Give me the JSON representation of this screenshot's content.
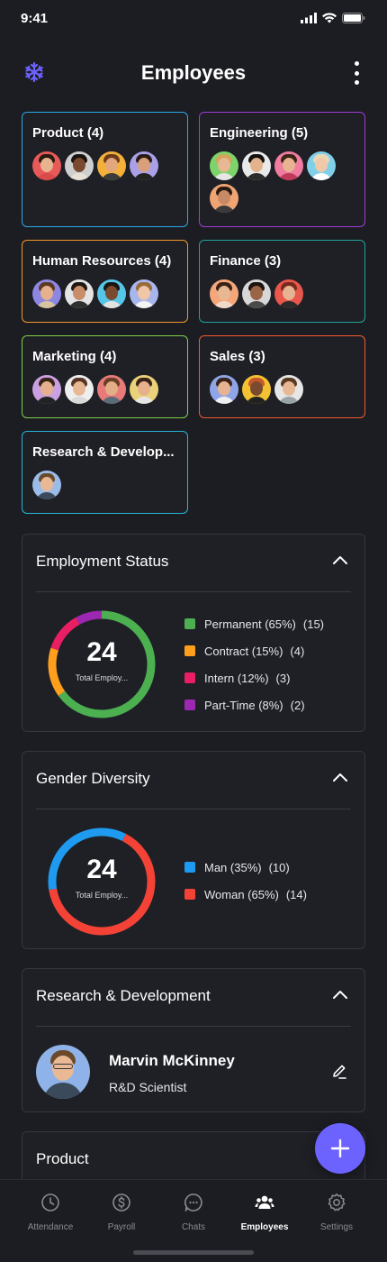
{
  "status_bar": {
    "time": "9:41"
  },
  "header": {
    "title": "Employees",
    "logo_icon": "snowflake-logo-icon",
    "menu_icon": "more-vertical-icon"
  },
  "departments": [
    {
      "name": "Product (4)",
      "border": "#2aa8e8",
      "avatars": [
        {
          "bg": "#e85a5a",
          "skin": "#e8b48f",
          "hair": "#2b1a12",
          "shirt": "#d94b4b"
        },
        {
          "bg": "#cfcfcf",
          "skin": "#7a4a2e",
          "hair": "#1b1410",
          "shirt": "#e8e2d6"
        },
        {
          "bg": "#f3b13a",
          "skin": "#e3a77d",
          "hair": "#6b3b1c",
          "shirt": "#3b3b3b"
        },
        {
          "bg": "#a9a0e8",
          "skin": "#d9a07b",
          "hair": "#2a1c15",
          "shirt": "#222"
        }
      ]
    },
    {
      "name": "Engineering (5)",
      "border": "#a33ad6",
      "avatars": [
        {
          "bg": "#7ed36a",
          "skin": "#e8b892",
          "hair": "#d3a45c",
          "shirt": "#e5e5e5"
        },
        {
          "bg": "#e9e9e9",
          "skin": "#e2b38c",
          "hair": "#111",
          "shirt": "#2b2b2b"
        },
        {
          "bg": "#f07ca0",
          "skin": "#e7b391",
          "hair": "#3a2418",
          "shirt": "#c23a5a"
        },
        {
          "bg": "#7fd0e8",
          "skin": "#efc9a9",
          "hair": "#e9d8b8",
          "shirt": "#fff"
        },
        {
          "bg": "#f0a474",
          "skin": "#c88a64",
          "hair": "#2b1a12",
          "shirt": "#3a3a3a"
        }
      ]
    },
    {
      "name": "Human Resources (4)",
      "border": "#f0982a",
      "avatars": [
        {
          "bg": "#8e86e3",
          "skin": "#e6b18c",
          "hair": "#5a3a22",
          "shirt": "#d8c3a0"
        },
        {
          "bg": "#e4e4e4",
          "skin": "#c98d6a",
          "hair": "#1f1712",
          "shirt": "#2f2f2f"
        },
        {
          "bg": "#55c6e8",
          "skin": "#7a4a2e",
          "hair": "#1b1410",
          "shirt": "#e2e2e2"
        },
        {
          "bg": "#a7b6ec",
          "skin": "#efc6a6",
          "hair": "#9a6a3a",
          "shirt": "#f3f3f3"
        }
      ]
    },
    {
      "name": "Finance (3)",
      "border": "#1fa39a",
      "avatars": [
        {
          "bg": "#f4a77a",
          "skin": "#e8b894",
          "hair": "#3a2216",
          "shirt": "#f0d8c8"
        },
        {
          "bg": "#d7d7d7",
          "skin": "#9a6446",
          "hair": "#1c1410",
          "shirt": "#4a4a4a"
        },
        {
          "bg": "#e8574b",
          "skin": "#e7b493",
          "hair": "#7a2a1c",
          "shirt": "#2a2a2a"
        }
      ]
    },
    {
      "name": "Marketing (4)",
      "border": "#7ccf4a",
      "avatars": [
        {
          "bg": "#c9a0e0",
          "skin": "#e5b08d",
          "hair": "#3a2418",
          "shirt": "#222"
        },
        {
          "bg": "#eeeeee",
          "skin": "#e8b794",
          "hair": "#5a3524",
          "shirt": "#d9d9d9"
        },
        {
          "bg": "#e87a7a",
          "skin": "#e3ad88",
          "hair": "#6a4024",
          "shirt": "#5a6b7a"
        },
        {
          "bg": "#e9d27a",
          "skin": "#e6b18c",
          "hair": "#3a2418",
          "shirt": "#e6e6e6"
        }
      ]
    },
    {
      "name": "Sales (3)",
      "border": "#f05a30",
      "avatars": [
        {
          "bg": "#8ea6e8",
          "skin": "#e7b391",
          "hair": "#3a2418",
          "shirt": "#f0f0f0"
        },
        {
          "bg": "#f3c233",
          "skin": "#7a4a2e",
          "hair": "#c8582a",
          "shirt": "#222"
        },
        {
          "bg": "#e6e6e6",
          "skin": "#e8b894",
          "hair": "#5a3a22",
          "shirt": "#9aa3a8"
        }
      ]
    },
    {
      "name": "Research & Develop...",
      "border": "#25b6d8",
      "avatars": [
        {
          "bg": "#9bbce8",
          "skin": "#e9b996",
          "hair": "#6b4a2c",
          "shirt": "#3a4a5a"
        }
      ]
    }
  ],
  "employment_status": {
    "title": "Employment Status",
    "total": "24",
    "total_label": "Total Employ...",
    "items": [
      {
        "label": "Permanent (65%)",
        "count": "(15)",
        "value": 65,
        "color": "#4caf50"
      },
      {
        "label": "Contract (15%)",
        "count": "(4)",
        "value": 15,
        "color": "#ff9f1c"
      },
      {
        "label": "Intern (12%)",
        "count": "(3)",
        "value": 12,
        "color": "#e91e63"
      },
      {
        "label": "Part-Time (8%)",
        "count": "(2)",
        "value": 8,
        "color": "#9c27b0"
      }
    ]
  },
  "gender_diversity": {
    "title": "Gender Diversity",
    "total": "24",
    "total_label": "Total Employ...",
    "items": [
      {
        "label": "Man (35%)",
        "count": "(10)",
        "value": 35,
        "color": "#1e9bf0"
      },
      {
        "label": "Woman (65%)",
        "count": "(14)",
        "value": 65,
        "color": "#f44336"
      }
    ]
  },
  "rnd_panel": {
    "title": "Research & Development",
    "employee": {
      "name": "Marvin McKinney",
      "role": "R&D Scientist"
    }
  },
  "product_panel": {
    "title": "Product"
  },
  "bottom_nav": [
    {
      "label": "Attendance",
      "icon": "clock-icon",
      "active": false
    },
    {
      "label": "Payroll",
      "icon": "dollar-icon",
      "active": false
    },
    {
      "label": "Chats",
      "icon": "chat-bubble-icon",
      "active": false
    },
    {
      "label": "Employees",
      "icon": "people-icon",
      "active": true
    },
    {
      "label": "Settings",
      "icon": "gear-icon",
      "active": false
    }
  ]
}
